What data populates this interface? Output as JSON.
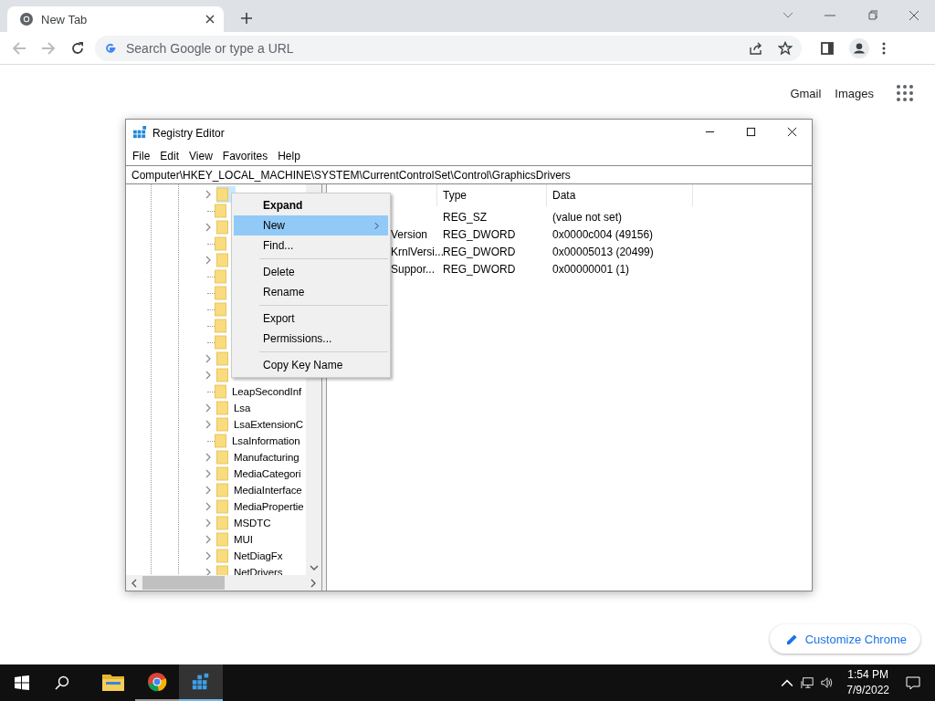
{
  "browser": {
    "tab": {
      "title": "New Tab"
    },
    "omnibox": {
      "placeholder": "Search Google or type a URL"
    },
    "links": [
      "Gmail",
      "Images"
    ],
    "customize_button": "Customize Chrome"
  },
  "regedit": {
    "title": "Registry Editor",
    "menu": [
      "File",
      "Edit",
      "View",
      "Favorites",
      "Help"
    ],
    "address": "Computer\\HKEY_LOCAL_MACHINE\\SYSTEM\\CurrentControlSet\\Control\\GraphicsDrivers",
    "tree": [
      {
        "expandable": true,
        "selected": true
      },
      {
        "expandable": false,
        "selected": false
      },
      {
        "expandable": true,
        "selected": false
      },
      {
        "expandable": false,
        "selected": false
      },
      {
        "expandable": true,
        "selected": false
      },
      {
        "expandable": false,
        "selected": false
      },
      {
        "expandable": false,
        "selected": false
      },
      {
        "expandable": false,
        "selected": false
      },
      {
        "expandable": false,
        "selected": false
      },
      {
        "expandable": false,
        "selected": false
      },
      {
        "expandable": true,
        "selected": false
      },
      {
        "expandable": true,
        "selected": false
      },
      {
        "label": "LeapSecondInf",
        "expandable": false,
        "selected": false
      },
      {
        "label": "Lsa",
        "expandable": true,
        "selected": false
      },
      {
        "label": "LsaExtensionC",
        "expandable": true,
        "selected": false
      },
      {
        "label": "LsaInformation",
        "expandable": false,
        "selected": false
      },
      {
        "label": "Manufacturing",
        "expandable": true,
        "selected": false
      },
      {
        "label": "MediaCategori",
        "expandable": true,
        "selected": false
      },
      {
        "label": "MediaInterface",
        "expandable": true,
        "selected": false
      },
      {
        "label": "MediaPropertie",
        "expandable": true,
        "selected": false
      },
      {
        "label": "MSDTC",
        "expandable": true,
        "selected": false
      },
      {
        "label": "MUI",
        "expandable": true,
        "selected": false
      },
      {
        "label": "NetDiagFx",
        "expandable": true,
        "selected": false
      },
      {
        "label": "NetDrivers",
        "expandable": true,
        "selected": false
      }
    ],
    "columns": [
      "Type",
      "Data"
    ],
    "values": [
      {
        "type": "REG_SZ",
        "data": "(value not set)"
      },
      {
        "name": "Version",
        "type": "REG_DWORD",
        "data": "0x0000c004 (49156)"
      },
      {
        "name": "KrnlVersi...",
        "type": "REG_DWORD",
        "data": "0x00005013 (20499)"
      },
      {
        "name": "Suppor...",
        "type": "REG_DWORD",
        "data": "0x00000001 (1)"
      }
    ],
    "context_menu": [
      {
        "kind": "item",
        "label": "Expand",
        "bold": true,
        "selected": false,
        "submenu": false
      },
      {
        "kind": "item",
        "label": "New",
        "bold": false,
        "selected": true,
        "submenu": true
      },
      {
        "kind": "item",
        "label": "Find...",
        "bold": false,
        "selected": false,
        "submenu": false
      },
      {
        "kind": "separator"
      },
      {
        "kind": "item",
        "label": "Delete",
        "bold": false,
        "selected": false,
        "submenu": false
      },
      {
        "kind": "item",
        "label": "Rename",
        "bold": false,
        "selected": false,
        "submenu": false
      },
      {
        "kind": "separator"
      },
      {
        "kind": "item",
        "label": "Export",
        "bold": false,
        "selected": false,
        "submenu": false
      },
      {
        "kind": "item",
        "label": "Permissions...",
        "bold": false,
        "selected": false,
        "submenu": false
      },
      {
        "kind": "separator"
      },
      {
        "kind": "item",
        "label": "Copy Key Name",
        "bold": false,
        "selected": false,
        "submenu": false
      }
    ]
  },
  "taskbar": {
    "apps": [
      {
        "kind": "explorer",
        "running": false,
        "active": false
      },
      {
        "kind": "chrome",
        "running": true,
        "active": false
      },
      {
        "kind": "regedit",
        "running": true,
        "active": true
      }
    ],
    "time": "1:54 PM",
    "date": "7/9/2022"
  }
}
